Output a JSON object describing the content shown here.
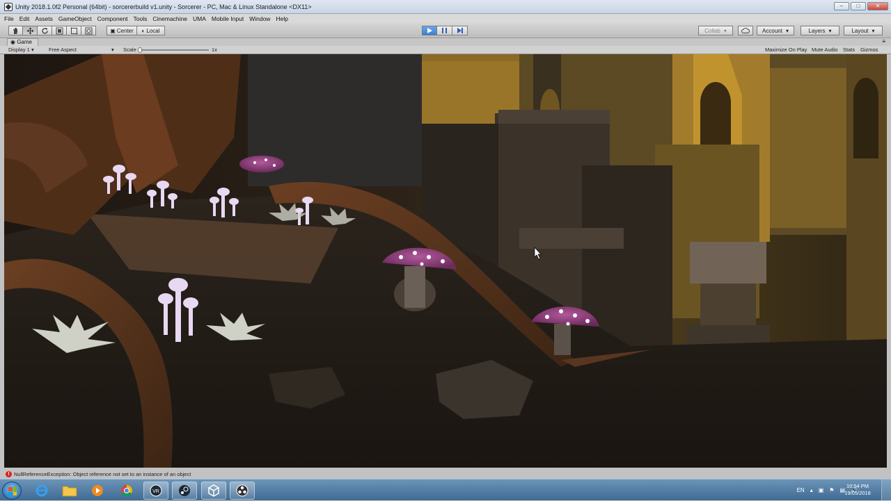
{
  "window": {
    "title": "Unity 2018.1.0f2 Personal (64bit) - sorcererbuild v1.unity - Sorcerer - PC, Mac & Linux Standalone <DX11>",
    "controls": [
      "minimize",
      "maximize",
      "close"
    ]
  },
  "menu": [
    "File",
    "Edit",
    "Assets",
    "GameObject",
    "Component",
    "Tools",
    "Cinemachine",
    "UMA",
    "Mobile Input",
    "Window",
    "Help"
  ],
  "toolbar": {
    "tools": [
      "hand-tool",
      "move-tool",
      "rotate-tool",
      "scale-tool",
      "rect-tool",
      "transform-tool"
    ],
    "pivot_label": "Center",
    "space_label": "Local",
    "play_state": "playing",
    "collab_label": "Collab",
    "account_label": "Account",
    "layers_label": "Layers",
    "layout_label": "Layout"
  },
  "game_tab": {
    "label": "Game",
    "display": "Display 1",
    "aspect": "Free Aspect",
    "scale_label": "Scale",
    "scale_value": "1x",
    "maximize_on_play": "Maximize On Play",
    "mute_audio": "Mute Audio",
    "stats": "Stats",
    "gizmos": "Gizmos"
  },
  "status": {
    "message": "NullReferenceException: Object reference not set to an instance of an object",
    "level": "error"
  },
  "taskbar": {
    "apps": [
      "internet-explorer",
      "file-explorer",
      "media-player",
      "chrome",
      "vr-app",
      "steam",
      "unity",
      "obs"
    ],
    "language": "EN",
    "time": "10:54 PM",
    "date": "19/05/2018"
  },
  "colors": {
    "unity_chrome": "#c2c2c2",
    "play_active": "#3b7fd1",
    "error": "#d22222",
    "taskbar": "#3f6a93"
  }
}
